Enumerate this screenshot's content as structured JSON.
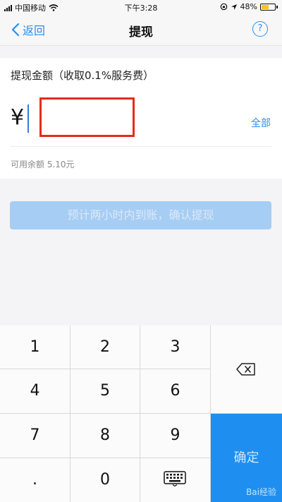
{
  "status_bar": {
    "carrier": "中国移动",
    "time": "下午3:28",
    "battery": "48%"
  },
  "nav": {
    "back_label": "返回",
    "title": "提现",
    "help_label": "?"
  },
  "form": {
    "amount_label": "提现金额（收取0.1%服务费）",
    "currency_symbol": "¥",
    "amount_value": "",
    "all_label": "全部",
    "balance_text": "可用余额 5.10元"
  },
  "confirm_label": "预计两小时内到账，确认提现",
  "keypad": {
    "keys": [
      "1",
      "2",
      "3",
      "4",
      "5",
      "6",
      "7",
      "8",
      "9",
      ".",
      "0"
    ],
    "confirm_label": "确定"
  },
  "watermark": "Bai经验",
  "colors": {
    "accent": "#2a8ef0",
    "confirm_disabled": "#a6cdf3",
    "highlight_box": "#e42a1e"
  },
  "icons": [
    "back-chevron-icon",
    "help-icon",
    "backspace-icon",
    "keyboard-icon",
    "wifi-icon",
    "location-icon",
    "lock-rotation-icon",
    "battery-icon"
  ]
}
